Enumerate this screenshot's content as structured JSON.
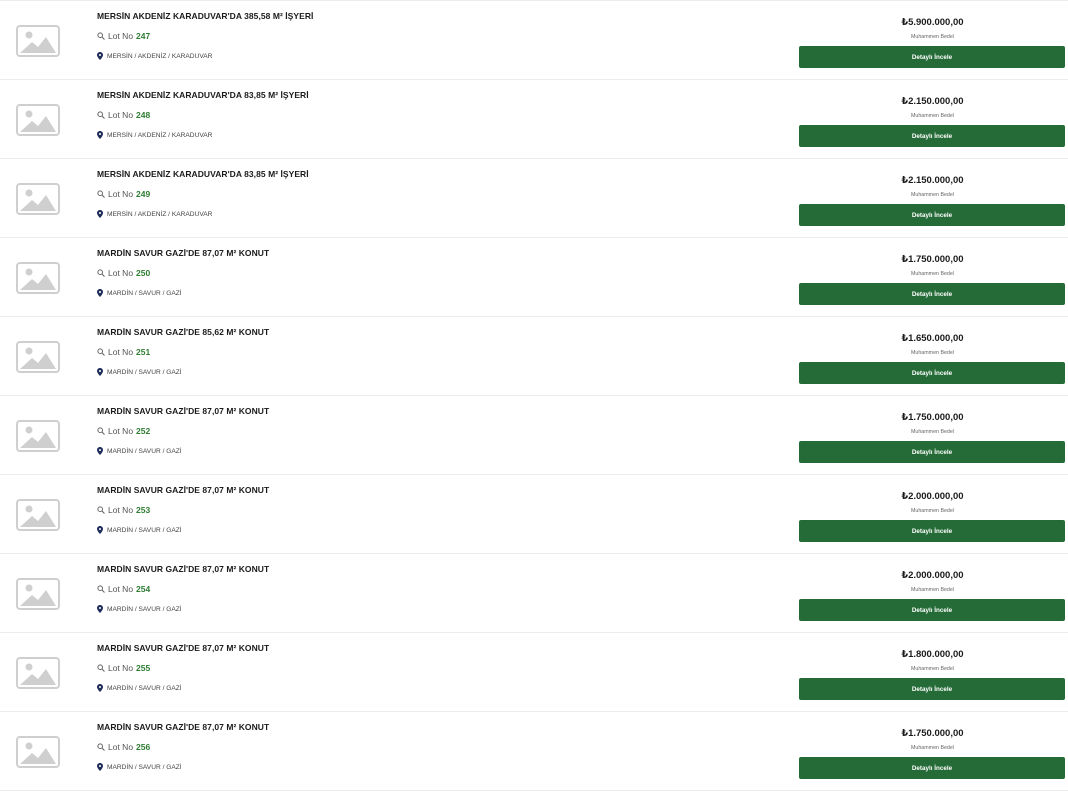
{
  "listings": [
    {
      "title": "MERSİN AKDENİZ KARADUVAR'DA 385,58 M² İŞYERİ",
      "lot_label": "Lot No",
      "lot_no": "247",
      "location": "MERSİN / AKDENİZ / KARADUVAR",
      "price": "₺5.900.000,00",
      "price_label": "Muhammen Bedel",
      "button": "Detaylı İncele"
    },
    {
      "title": "MERSİN AKDENİZ KARADUVAR'DA 83,85 M² İŞYERİ",
      "lot_label": "Lot No",
      "lot_no": "248",
      "location": "MERSİN / AKDENİZ / KARADUVAR",
      "price": "₺2.150.000,00",
      "price_label": "Muhammen Bedel",
      "button": "Detaylı İncele"
    },
    {
      "title": "MERSİN AKDENİZ KARADUVAR'DA 83,85 M² İŞYERİ",
      "lot_label": "Lot No",
      "lot_no": "249",
      "location": "MERSİN / AKDENİZ / KARADUVAR",
      "price": "₺2.150.000,00",
      "price_label": "Muhammen Bedel",
      "button": "Detaylı İncele"
    },
    {
      "title": "MARDİN SAVUR GAZİ'DE 87,07 M² KONUT",
      "lot_label": "Lot No",
      "lot_no": "250",
      "location": "MARDİN / SAVUR / GAZİ",
      "price": "₺1.750.000,00",
      "price_label": "Muhammen Bedel",
      "button": "Detaylı İncele"
    },
    {
      "title": "MARDİN SAVUR GAZİ'DE 85,62 M² KONUT",
      "lot_label": "Lot No",
      "lot_no": "251",
      "location": "MARDİN / SAVUR / GAZİ",
      "price": "₺1.650.000,00",
      "price_label": "Muhammen Bedel",
      "button": "Detaylı İncele"
    },
    {
      "title": "MARDİN SAVUR GAZİ'DE 87,07 M² KONUT",
      "lot_label": "Lot No",
      "lot_no": "252",
      "location": "MARDİN / SAVUR / GAZİ",
      "price": "₺1.750.000,00",
      "price_label": "Muhammen Bedel",
      "button": "Detaylı İncele"
    },
    {
      "title": "MARDİN SAVUR GAZİ'DE 87,07 M² KONUT",
      "lot_label": "Lot No",
      "lot_no": "253",
      "location": "MARDİN / SAVUR / GAZİ",
      "price": "₺2.000.000,00",
      "price_label": "Muhammen Bedel",
      "button": "Detaylı İncele"
    },
    {
      "title": "MARDİN SAVUR GAZİ'DE 87,07 M² KONUT",
      "lot_label": "Lot No",
      "lot_no": "254",
      "location": "MARDİN / SAVUR / GAZİ",
      "price": "₺2.000.000,00",
      "price_label": "Muhammen Bedel",
      "button": "Detaylı İncele"
    },
    {
      "title": "MARDİN SAVUR GAZİ'DE 87,07 M² KONUT",
      "lot_label": "Lot No",
      "lot_no": "255",
      "location": "MARDİN / SAVUR / GAZİ",
      "price": "₺1.800.000,00",
      "price_label": "Muhammen Bedel",
      "button": "Detaylı İncele"
    },
    {
      "title": "MARDİN SAVUR GAZİ'DE 87,07 M² KONUT",
      "lot_label": "Lot No",
      "lot_no": "256",
      "location": "MARDİN / SAVUR / GAZİ",
      "price": "₺1.750.000,00",
      "price_label": "Muhammen Bedel",
      "button": "Detaylı İncele"
    }
  ],
  "icons": {
    "thumbnail": "image-placeholder-icon",
    "lot": "search-icon",
    "location": "map-pin-icon"
  },
  "colors": {
    "button": "#256b37",
    "lot_number": "#2e7d32",
    "placeholder": "#cfcfcf"
  }
}
